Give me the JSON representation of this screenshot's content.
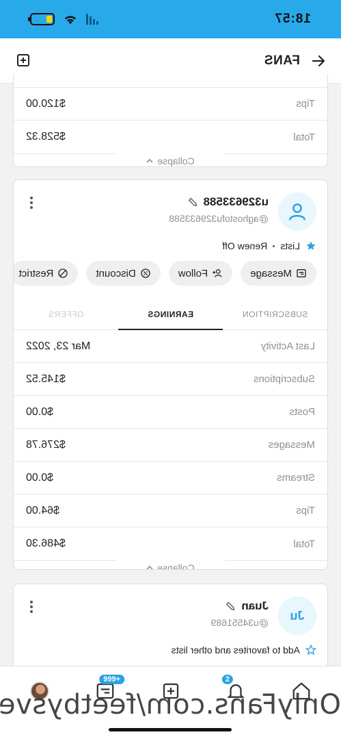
{
  "status": {
    "time": "18:57"
  },
  "header": {
    "title": "FANS"
  },
  "cards": [
    {
      "rows": [
        {
          "label": "Tips",
          "value": "$120.00"
        },
        {
          "label": "Total",
          "value": "$528.32"
        }
      ],
      "collapse": "Collapse"
    },
    {
      "user": {
        "initials": "",
        "name": "u329633588",
        "handle": "@aghostofu329633588"
      },
      "lists_label": "Lists",
      "renew_label": "Renew Off",
      "actions": [
        "Message",
        "Follow",
        "Discount",
        "Restrict"
      ],
      "tabs": [
        "SUBSCRIPTION",
        "EARNINGS",
        "OFFERS"
      ],
      "rows": [
        {
          "label": "Last Activity",
          "value": "Mar 23, 2022"
        },
        {
          "label": "Subscriptions",
          "value": "$145.52"
        },
        {
          "label": "Posts",
          "value": "$0.00"
        },
        {
          "label": "Messages",
          "value": "$276.78"
        },
        {
          "label": "Streams",
          "value": "$0.00"
        },
        {
          "label": "Tips",
          "value": "$64.00"
        },
        {
          "label": "Total",
          "value": "$486.30"
        }
      ],
      "collapse": "Collapse"
    },
    {
      "user": {
        "initials": "Ju",
        "name": "Juan",
        "handle": "@u34551689"
      },
      "favorites_label": "Add to favorites and other lists"
    }
  ],
  "nav": {
    "notifications_badge": "2",
    "messages_badge": "999+"
  },
  "watermark": "OnlyFans.com/feetbysvett"
}
